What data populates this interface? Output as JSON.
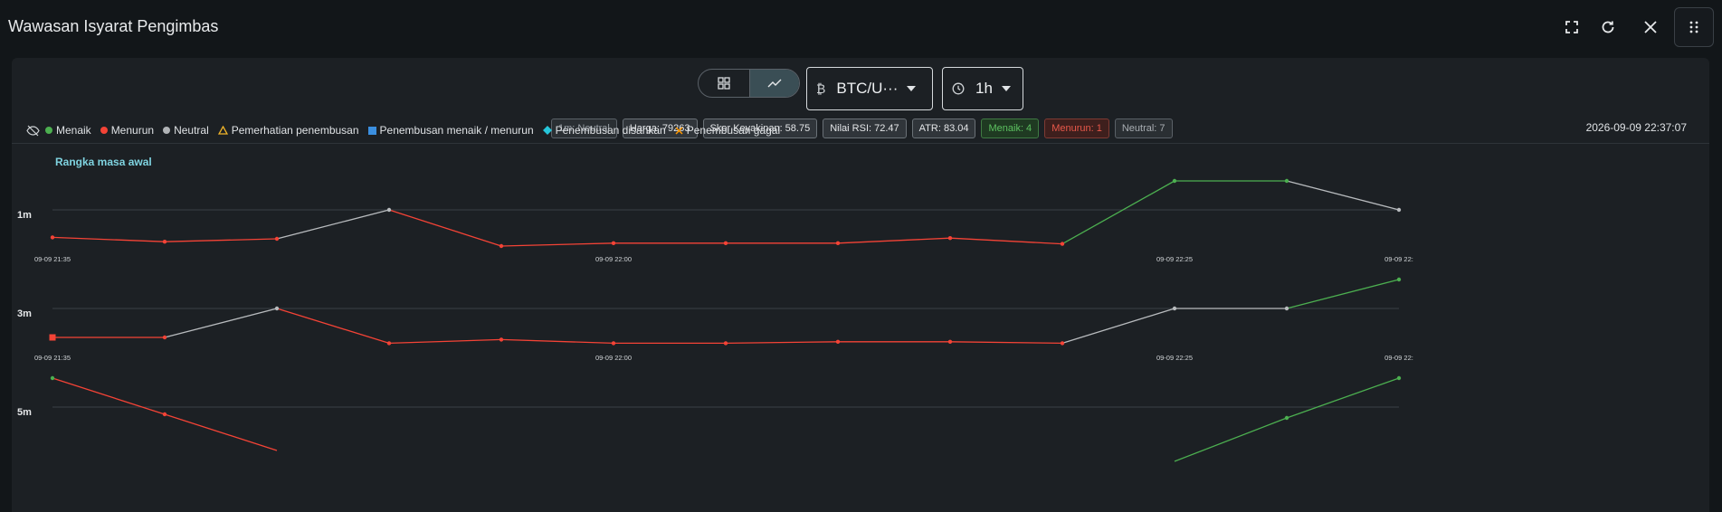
{
  "window": {
    "title": "Wawasan Isyarat Pengimbas"
  },
  "toolbar": {
    "symbol": "BTC/U···",
    "symbol_icon": "bitcoin-icon",
    "timeframe": "1h",
    "timeframe_icon": "clock-icon"
  },
  "badges": [
    {
      "label": "1m: Neutral",
      "kind": "muted"
    },
    {
      "label": "Harga: 79263",
      "kind": "info"
    },
    {
      "label": "Skor Keyakinan: 58.75",
      "kind": "info"
    },
    {
      "label": "Nilai RSI: 72.47",
      "kind": "info"
    },
    {
      "label": "ATR: 83.04",
      "kind": "info"
    },
    {
      "label": "Menaik: 4",
      "kind": "up"
    },
    {
      "label": "Menurun: 1",
      "kind": "down"
    },
    {
      "label": "Neutral: 7",
      "kind": "neutral"
    }
  ],
  "legend": [
    {
      "label": "Menaik",
      "symbol": "dot",
      "color": "#4caf50"
    },
    {
      "label": "Menurun",
      "symbol": "dot",
      "color": "#f44336"
    },
    {
      "label": "Neutral",
      "symbol": "dot",
      "color": "#b0b3b6"
    },
    {
      "label": "Pemerhatian penembusan",
      "symbol": "triangle",
      "color": "#f0b429"
    },
    {
      "label": "Penembusan menaik / menurun",
      "symbol": "square",
      "color": "#3b8fe0"
    },
    {
      "label": "Penembusan disahkan",
      "symbol": "diamond",
      "color": "#26c6da"
    },
    {
      "label": "Penembusan gagal",
      "symbol": "cross",
      "color": "#ff9800"
    }
  ],
  "timestamp": "2026-09-09 22:37:07",
  "section_title": "Rangka masa awal",
  "colors": {
    "up": "#4caf50",
    "down": "#f44336",
    "neutral": "#b8bbbe"
  },
  "chart_data": {
    "type": "line",
    "x": [
      "09-09 21:35",
      "09-09 21:40",
      "09-09 21:45",
      "09-09 21:50",
      "09-09 21:55",
      "09-09 22:00",
      "09-09 22:05",
      "09-09 22:10",
      "09-09 22:15",
      "09-09 22:20",
      "09-09 22:25",
      "09-09 22:30",
      "09-09 22:35"
    ],
    "x_tick_labels": [
      "09-09 21:35",
      "09-09 22:00",
      "09-09 22:25",
      "09-09 22:"
    ],
    "grid": true,
    "series": [
      {
        "name": "1m",
        "values": [
          0.62,
          0.56,
          0.6,
          1.0,
          0.5,
          0.54,
          0.54,
          0.54,
          0.61,
          0.53,
          1.4,
          1.4,
          1.0
        ],
        "states": [
          "down",
          "down",
          "down",
          "neutral",
          "down",
          "down",
          "down",
          "down",
          "down",
          "down",
          "up",
          "up",
          "neutral"
        ]
      },
      {
        "name": "3m",
        "values": [
          0.6,
          0.6,
          1.0,
          0.52,
          0.57,
          0.52,
          0.52,
          0.54,
          0.54,
          0.52,
          1.0,
          1.0,
          1.4
        ],
        "states": [
          "down",
          "down",
          "neutral",
          "down",
          "down",
          "down",
          "down",
          "down",
          "down",
          "down",
          "neutral",
          "neutral",
          "up"
        ],
        "breakout_index": 0
      },
      {
        "name": "5m",
        "values": [
          1.4,
          0.9,
          null,
          null,
          null,
          null,
          null,
          null,
          null,
          null,
          null,
          0.85,
          1.4
        ],
        "states": [
          "up",
          "down",
          "down",
          "down",
          "down",
          "down",
          "down",
          "down",
          "down",
          "down",
          "down",
          "up",
          "up"
        ]
      }
    ]
  }
}
